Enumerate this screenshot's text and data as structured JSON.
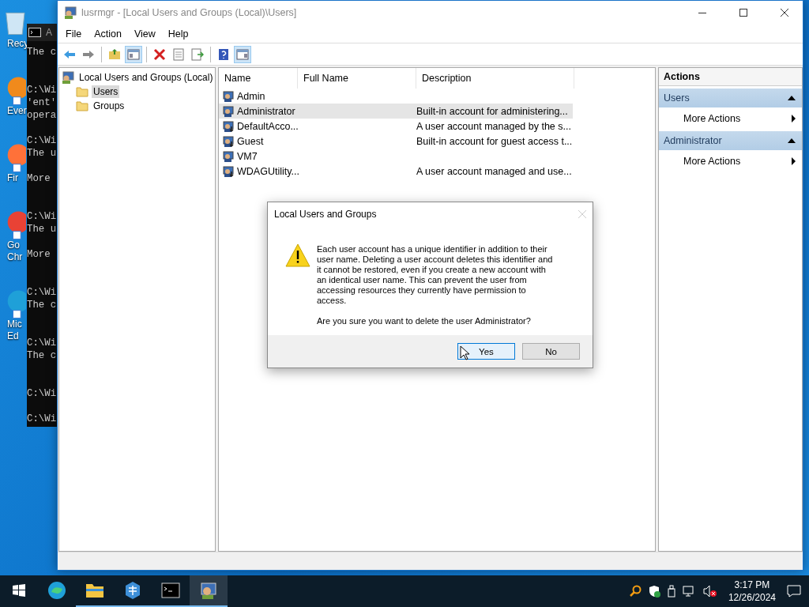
{
  "desktop": {
    "icons": [
      {
        "kind": "recycle",
        "lines": [
          "Recy"
        ]
      },
      {
        "kind": "orange",
        "lines": [
          "Ever"
        ]
      },
      {
        "kind": "firefox",
        "lines": [
          "Fir"
        ]
      },
      {
        "kind": "chrome",
        "lines": [
          "Go",
          "Chr"
        ]
      },
      {
        "kind": "edge",
        "lines": [
          "Mic",
          "Ed"
        ]
      }
    ]
  },
  "console": {
    "title": "A",
    "lines": [
      {
        "kind": "text",
        "text": "The c"
      },
      {
        "kind": "blank"
      },
      {
        "kind": "blank"
      },
      {
        "kind": "text",
        "text": "C:\\Wi"
      },
      {
        "kind": "text",
        "text": "'ent'"
      },
      {
        "kind": "text",
        "text": "opera"
      },
      {
        "kind": "blank"
      },
      {
        "kind": "text",
        "text": "C:\\Wi"
      },
      {
        "kind": "text",
        "text": "The u"
      },
      {
        "kind": "blank"
      },
      {
        "kind": "text",
        "text": "More"
      },
      {
        "kind": "blank"
      },
      {
        "kind": "blank"
      },
      {
        "kind": "text",
        "text": "C:\\Wi"
      },
      {
        "kind": "text",
        "text": "The u"
      },
      {
        "kind": "blank"
      },
      {
        "kind": "text",
        "text": "More"
      },
      {
        "kind": "blank"
      },
      {
        "kind": "blank"
      },
      {
        "kind": "text",
        "text": "C:\\Wi"
      },
      {
        "kind": "text",
        "text": "The c"
      },
      {
        "kind": "blank"
      },
      {
        "kind": "blank"
      },
      {
        "kind": "text",
        "text": "C:\\Wi"
      },
      {
        "kind": "text",
        "text": "The c"
      },
      {
        "kind": "blank"
      },
      {
        "kind": "blank"
      },
      {
        "kind": "text",
        "text": "C:\\Wi"
      },
      {
        "kind": "blank"
      },
      {
        "kind": "text",
        "text": "C:\\Wi"
      }
    ]
  },
  "window": {
    "title": "lusrmgr - [Local Users and Groups (Local)\\Users]",
    "menu": [
      "File",
      "Action",
      "View",
      "Help"
    ],
    "toolbar": [
      {
        "kind": "back",
        "pressed": false
      },
      {
        "kind": "forward",
        "pressed": false
      },
      {
        "kind": "separator"
      },
      {
        "kind": "up",
        "pressed": false
      },
      {
        "kind": "tree",
        "pressed": true
      },
      {
        "kind": "separator"
      },
      {
        "kind": "delete",
        "pressed": false
      },
      {
        "kind": "properties",
        "pressed": false
      },
      {
        "kind": "export",
        "pressed": false
      },
      {
        "kind": "separator"
      },
      {
        "kind": "help",
        "pressed": false
      },
      {
        "kind": "pane",
        "pressed": true
      }
    ],
    "tree": {
      "label": "Local Users and Groups (Local)",
      "children": [
        {
          "label": "Users",
          "selected": true
        },
        {
          "label": "Groups",
          "selected": false
        }
      ]
    },
    "table": {
      "columns": [
        "Name",
        "Full Name",
        "Description"
      ],
      "rows": [
        {
          "name": "Admin",
          "disabled": false,
          "selected": false
        },
        {
          "name": "Administrator",
          "description": "Built-in account for administering...",
          "disabled": false,
          "selected": true
        },
        {
          "name": "DefaultAcco...",
          "description": "A user account managed by the s...",
          "disabled": true,
          "selected": false
        },
        {
          "name": "Guest",
          "description": "Built-in account for guest access t...",
          "disabled": true,
          "selected": false
        },
        {
          "name": "VM7",
          "disabled": false,
          "selected": false
        },
        {
          "name": "WDAGUtility...",
          "description": "A user account managed and use...",
          "disabled": true,
          "selected": false
        }
      ]
    },
    "actions": {
      "title": "Actions",
      "sections": [
        {
          "title": "Users",
          "expanded": true,
          "items": [
            "More Actions"
          ]
        },
        {
          "title": "Administrator",
          "expanded": true,
          "items": [
            "More Actions"
          ]
        }
      ]
    }
  },
  "dialog": {
    "title": "Local Users and Groups",
    "message": "Each user account has a unique identifier in addition to their user name. Deleting a user account deletes this identifier and it cannot be restored, even if you create a new account with an identical user name. This can prevent the user from accessing resources they currently have permission to access.",
    "question": "Are you sure you want to delete the user Administrator?",
    "buttons": [
      {
        "label": "Yes",
        "focused": true
      },
      {
        "label": "No",
        "focused": false
      }
    ]
  },
  "taskbar": {
    "apps": [
      {
        "kind": "edge",
        "active": false,
        "running": false
      },
      {
        "kind": "explorer",
        "active": false,
        "running": true
      },
      {
        "kind": "network",
        "active": false,
        "running": true
      },
      {
        "kind": "console",
        "active": false,
        "running": true
      },
      {
        "kind": "lusrmgr",
        "active": true,
        "running": true
      }
    ],
    "time": "3:17 PM",
    "date": "12/26/2024"
  }
}
